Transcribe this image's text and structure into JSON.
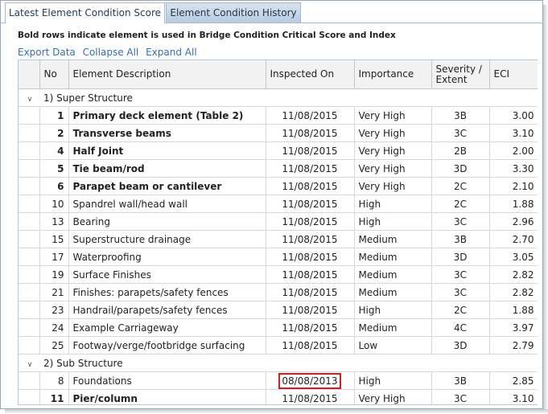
{
  "tabs": [
    {
      "label": "Latest Element Condition Score",
      "active": true
    },
    {
      "label": "Element Condition History",
      "active": false
    }
  ],
  "note": "Bold rows indicate element is used in Bridge Condition Critical Score and Index",
  "actions": {
    "export": "Export Data",
    "collapse": "Collapse All",
    "expand": "Expand All"
  },
  "columns": {
    "no": "No",
    "description": "Element Description",
    "inspected": "Inspected On",
    "importance": "Importance",
    "severity": "Severity / Extent",
    "eci": "ECI"
  },
  "groups": [
    {
      "label": "1) Super Structure",
      "rows": [
        {
          "no": "1",
          "desc": "Primary deck element (Table 2)",
          "date": "11/08/2015",
          "imp": "Very High",
          "sev": "3B",
          "eci": "3.00",
          "bold": true
        },
        {
          "no": "2",
          "desc": "Transverse beams",
          "date": "11/08/2015",
          "imp": "Very High",
          "sev": "3C",
          "eci": "3.10",
          "bold": true
        },
        {
          "no": "4",
          "desc": "Half Joint",
          "date": "11/08/2015",
          "imp": "Very High",
          "sev": "2B",
          "eci": "2.00",
          "bold": true
        },
        {
          "no": "5",
          "desc": "Tie beam/rod",
          "date": "11/08/2015",
          "imp": "Very High",
          "sev": "3D",
          "eci": "3.30",
          "bold": true
        },
        {
          "no": "6",
          "desc": "Parapet beam or cantilever",
          "date": "11/08/2015",
          "imp": "Very High",
          "sev": "2C",
          "eci": "2.10",
          "bold": true
        },
        {
          "no": "10",
          "desc": "Spandrel wall/head wall",
          "date": "11/08/2015",
          "imp": "High",
          "sev": "2C",
          "eci": "1.88",
          "bold": false
        },
        {
          "no": "13",
          "desc": "Bearing",
          "date": "11/08/2015",
          "imp": "High",
          "sev": "3C",
          "eci": "2.96",
          "bold": false
        },
        {
          "no": "15",
          "desc": "Superstructure drainage",
          "date": "11/08/2015",
          "imp": "Medium",
          "sev": "3B",
          "eci": "2.70",
          "bold": false
        },
        {
          "no": "17",
          "desc": "Waterproofing",
          "date": "11/08/2015",
          "imp": "Medium",
          "sev": "3D",
          "eci": "3.05",
          "bold": false
        },
        {
          "no": "19",
          "desc": "Surface Finishes",
          "date": "11/08/2015",
          "imp": "Medium",
          "sev": "3C",
          "eci": "2.82",
          "bold": false
        },
        {
          "no": "21",
          "desc": "Finishes: parapets/safety fences",
          "date": "11/08/2015",
          "imp": "Medium",
          "sev": "3C",
          "eci": "2.82",
          "bold": false
        },
        {
          "no": "23",
          "desc": "Handrail/parapets/safety fences",
          "date": "11/08/2015",
          "imp": "High",
          "sev": "2C",
          "eci": "1.88",
          "bold": false
        },
        {
          "no": "24",
          "desc": "Example Carriageway",
          "date": "11/08/2015",
          "imp": "Medium",
          "sev": "4C",
          "eci": "3.97",
          "bold": false
        },
        {
          "no": "25",
          "desc": "Footway/verge/footbridge surfacing",
          "date": "11/08/2015",
          "imp": "Low",
          "sev": "3D",
          "eci": "2.79",
          "bold": false
        }
      ]
    },
    {
      "label": "2) Sub Structure",
      "rows": [
        {
          "no": "8",
          "desc": "Foundations",
          "date": "08/08/2013",
          "imp": "High",
          "sev": "3B",
          "eci": "2.85",
          "bold": false,
          "highlight": true
        },
        {
          "no": "11",
          "desc": "Pier/column",
          "date": "11/08/2015",
          "imp": "Very High",
          "sev": "3C",
          "eci": "3.10",
          "bold": true
        }
      ]
    }
  ]
}
